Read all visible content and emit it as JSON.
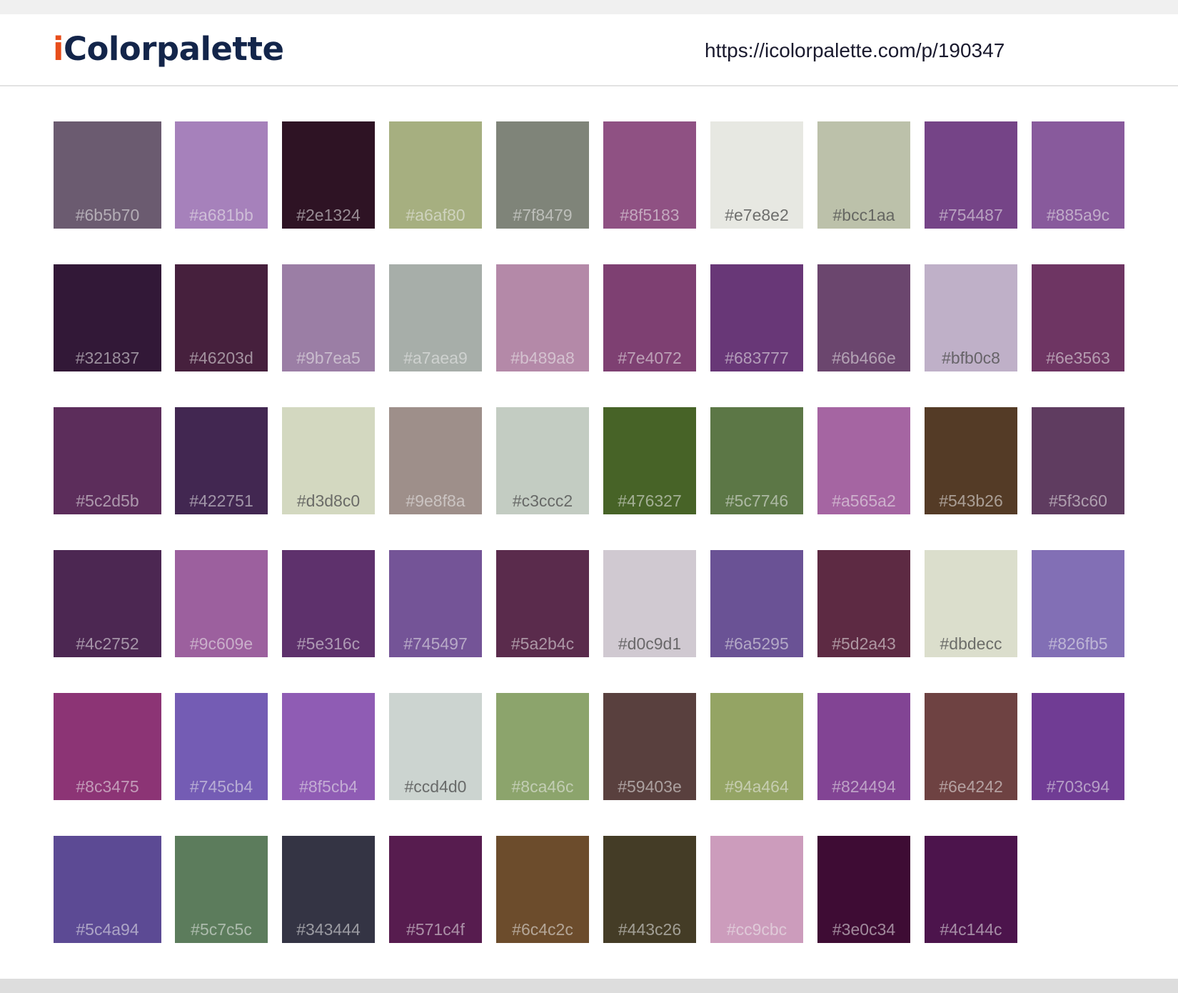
{
  "header": {
    "logo_first": "i",
    "logo_rest": "Colorpalette",
    "url": "https://icolorpalette.com/p/190347"
  },
  "swatches": [
    "#6b5b70",
    "#a681bb",
    "#2e1324",
    "#a6af80",
    "#7f8479",
    "#8f5183",
    "#e7e8e2",
    "#bcc1aa",
    "#754487",
    "#885a9c",
    "#321837",
    "#46203d",
    "#9b7ea5",
    "#a7aea9",
    "#b489a8",
    "#7e4072",
    "#683777",
    "#6b466e",
    "#bfb0c8",
    "#6e3563",
    "#5c2d5b",
    "#422751",
    "#d3d8c0",
    "#9e8f8a",
    "#c3ccc2",
    "#476327",
    "#5c7746",
    "#a565a2",
    "#543b26",
    "#5f3c60",
    "#4c2752",
    "#9c609e",
    "#5e316c",
    "#745497",
    "#5a2b4c",
    "#d0c9d1",
    "#6a5295",
    "#5d2a43",
    "#dbdecc",
    "#826fb5",
    "#8c3475",
    "#745cb4",
    "#8f5cb4",
    "#ccd4d0",
    "#8ca46c",
    "#59403e",
    "#94a464",
    "#824494",
    "#6e4242",
    "#703c94",
    "#5c4a94",
    "#5c7c5c",
    "#343444",
    "#571c4f",
    "#6c4c2c",
    "#443c26",
    "#cc9cbc",
    "#3e0c34",
    "#4c144c"
  ]
}
